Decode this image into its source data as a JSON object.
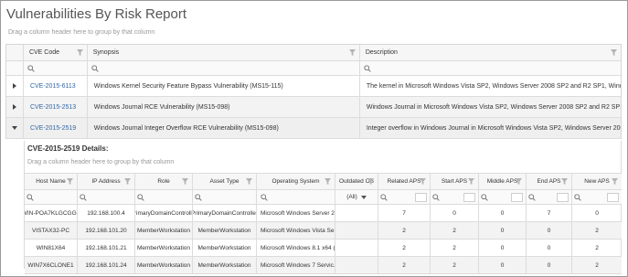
{
  "report": {
    "title": "Vulnerabilities By Risk Report",
    "group_hint": "Drag a column header here to group by that column"
  },
  "outer_grid": {
    "columns": [
      "CVE Code",
      "Synopsis",
      "Description"
    ],
    "rows": [
      {
        "cve": "CVE-2015-6113",
        "synopsis": "Windows Kernel Security Feature Bypass Vulnerability (MS15-115)",
        "description": "The kernel in Microsoft Windows Vista SP2, Windows Server 2008 SP2 and R2 SP1, Windows 7 SP1, Windows 8,"
      },
      {
        "cve": "CVE-2015-2513",
        "synopsis": "Windows Journal RCE Vulnerability (MS15-098)",
        "description": "Windows Journal in Microsoft Windows Vista SP2, Windows Server 2008 SP2 and R2 SP1, Windows 7 SP1, Windo"
      },
      {
        "cve": "CVE-2015-2519",
        "synopsis": "Windows Journal Integer Overflow RCE Vulnerability (MS15-098)",
        "description": "Integer overflow in Windows Journal in Microsoft Windows Vista SP2, Windows Server 2008 SP2 and R2 SP1, W"
      }
    ]
  },
  "details": {
    "title": "CVE-2015-2519 Details:",
    "group_hint": "Drag a column header here to group by that column",
    "columns": [
      "Host Name",
      "IP Address",
      "Role",
      "Asset Type",
      "Operating System",
      "Outdated OS",
      "Related APS",
      "Start APS",
      "Middle APS",
      "End APS",
      "New APS"
    ],
    "outdated_filter": "(All)",
    "rows": [
      {
        "host": "WIN-POA7KLGCGG0",
        "ip": "192.168.100.4",
        "role": "PrimaryDomainController",
        "asset": "PrimaryDomainController",
        "os": "Microsoft Windows Server 2...",
        "related": "7",
        "start": "0",
        "middle": "0",
        "end": "7",
        "new": "0"
      },
      {
        "host": "VISTAX32-PC",
        "ip": "192.168.101.20",
        "role": "MemberWorkstation",
        "asset": "MemberWorkstation",
        "os": "Microsoft Windows Vista Se...",
        "related": "2",
        "start": "2",
        "middle": "0",
        "end": "0",
        "new": "2"
      },
      {
        "host": "WIN81X64",
        "ip": "192.168.101.21",
        "role": "MemberWorkstation",
        "asset": "MemberWorkstation",
        "os": "Microsoft Windows 8.1 x64 (...",
        "related": "2",
        "start": "2",
        "middle": "0",
        "end": "0",
        "new": "2"
      },
      {
        "host": "WIN7X6CLONE1",
        "ip": "192.168.101.24",
        "role": "MemberWorkstation",
        "asset": "MemberWorkstation",
        "os": "Microsoft Windows 7 Servic...",
        "related": "2",
        "start": "2",
        "middle": "0",
        "end": "0",
        "new": "2"
      }
    ]
  },
  "colors": {
    "link": "#3366a3",
    "header_bg": "#f6f6f6",
    "border": "#dcdcdc",
    "expanded_row_bg": "#efefef"
  },
  "icons": {
    "filter": "funnel-icon",
    "search": "search-icon",
    "expand": "triangle-right-icon",
    "collapse": "triangle-down-icon",
    "dropdown": "dropdown-caret-icon"
  }
}
